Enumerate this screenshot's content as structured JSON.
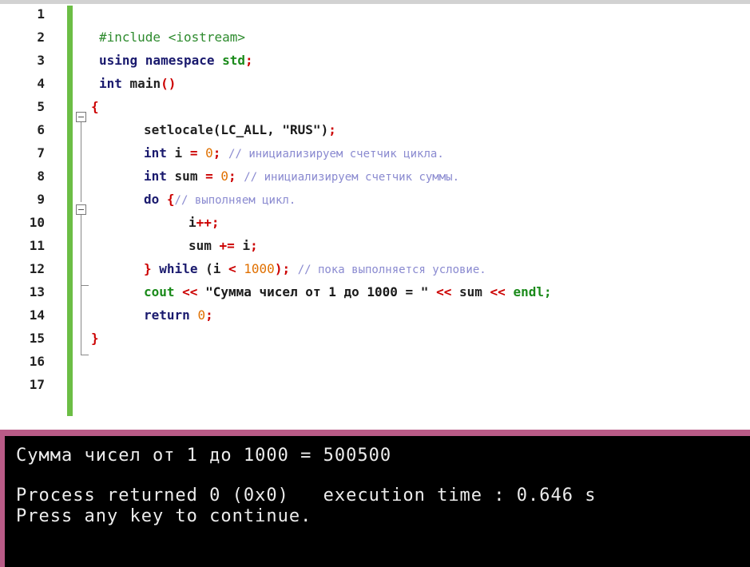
{
  "editor": {
    "line_numbers": [
      "1",
      "2",
      "3",
      "4",
      "5",
      "6",
      "7",
      "8",
      "9",
      "10",
      "11",
      "12",
      "13",
      "14",
      "15",
      "16",
      "17"
    ],
    "code": {
      "l2_include": "#include <iostream>",
      "l3_using": "using namespace",
      "l3_std": "std",
      "l3_semi": ";",
      "l4_int": "int",
      "l4_main": "main",
      "l4_parens": "()",
      "l5_brace": "{",
      "l6_fn": "setlocale",
      "l6_args": "(LC_ALL, \"RUS\")",
      "l6_semi": ";",
      "l7_int": "int",
      "l7_i": "i",
      "l7_eq": "=",
      "l7_zero": "0",
      "l7_semi": ";",
      "l7_comment": "// инициализируем счетчик цикла.",
      "l8_int": "int",
      "l8_sum": "sum",
      "l8_eq": "=",
      "l8_zero": "0",
      "l8_semi": ";",
      "l8_comment": "// инициализируем счетчик суммы.",
      "l9_do": "do",
      "l9_brace": "{",
      "l9_comment": "// выполняем цикл.",
      "l10_i": "i",
      "l10_op": "++;",
      "l11_sum": "sum",
      "l11_op": "+=",
      "l11_i": "i",
      "l11_semi": ";",
      "l12_brace": "}",
      "l12_while": "while",
      "l12_open": "(i",
      "l12_lt": "<",
      "l12_num": "1000",
      "l12_close": ");",
      "l12_comment": "// пока выполняется условие.",
      "l13_cout": "cout",
      "l13_op1": "<<",
      "l13_str": "\"Сумма чисел от 1 до 1000 = \"",
      "l13_op2": "<<",
      "l13_sum": "sum",
      "l13_op3": "<<",
      "l13_endl": "endl;",
      "l14_return": "return",
      "l14_zero": "0",
      "l14_semi": ";",
      "l15_brace": "}"
    }
  },
  "console": {
    "line1": "Сумма чисел от 1 до 1000 = 500500",
    "line2": "Process returned 0 (0x0)   execution time : 0.646 s",
    "line3": "Press any key to continue."
  },
  "colors": {
    "change_bar": "#6cbe45",
    "console_border": "#b95b87",
    "console_bg": "#000000",
    "keyword": "#1a1a6e",
    "comment": "#8a8ad0",
    "number": "#e07000",
    "operator": "#cc0000"
  }
}
